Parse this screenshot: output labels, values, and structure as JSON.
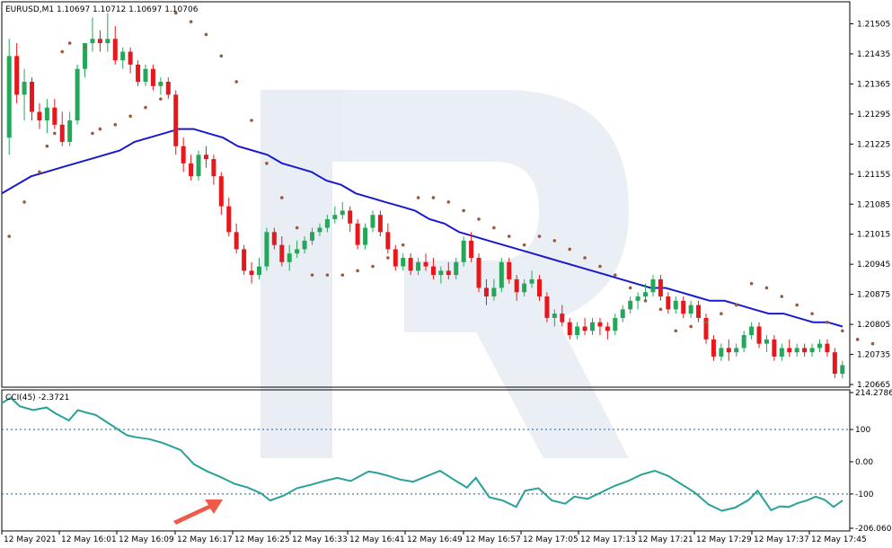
{
  "chart_data": [
    {
      "type": "candlestick",
      "title": "EURUSD,M1",
      "ohlc_header": "1.10697 1.10712 1.10697 1.10706",
      "ylim": [
        1.20665,
        1.2155
      ],
      "y_ticks": [
        "1.21505",
        "1.21435",
        "1.21365",
        "1.21295",
        "1.21225",
        "1.21155",
        "1.21085",
        "1.21015",
        "1.20945",
        "1.20875",
        "1.20805",
        "1.20735",
        "1.20665"
      ],
      "x_ticks": [
        "12 May 2021",
        "12 May 16:01",
        "12 May 16:09",
        "12 May 16:17",
        "12 May 16:25",
        "12 May 16:33",
        "12 May 16:41",
        "12 May 16:49",
        "12 May 16:57",
        "12 May 17:05",
        "12 May 17:13",
        "12 May 17:21",
        "12 May 17:29",
        "12 May 17:37",
        "12 May 17:45"
      ],
      "colors": {
        "bull": "#26a65b",
        "bear": "#e8171b",
        "ma": "#1a1acc",
        "sar": "#9c5a3c",
        "grid": "#d8d8d8"
      },
      "candles": [
        [
          1.2124,
          1.2147,
          1.212,
          1.2143
        ],
        [
          1.2143,
          1.2146,
          1.2132,
          1.2134
        ],
        [
          1.2134,
          1.214,
          1.2128,
          1.2137
        ],
        [
          1.2137,
          1.2138,
          1.2128,
          1.213
        ],
        [
          1.213,
          1.2132,
          1.2126,
          1.2128
        ],
        [
          1.2128,
          1.2133,
          1.2125,
          1.2131
        ],
        [
          1.2131,
          1.2133,
          1.2126,
          1.2127
        ],
        [
          1.2127,
          1.213,
          1.2122,
          1.2123
        ],
        [
          1.2123,
          1.213,
          1.2122,
          1.2128
        ],
        [
          1.2128,
          1.2141,
          1.2127,
          1.214
        ],
        [
          1.214,
          1.2146,
          1.2138,
          1.2146
        ],
        [
          1.2146,
          1.2152,
          1.2144,
          1.2147
        ],
        [
          1.2147,
          1.2149,
          1.2144,
          1.2146
        ],
        [
          1.2146,
          1.2153,
          1.2144,
          1.2147
        ],
        [
          1.2147,
          1.215,
          1.2141,
          1.2142
        ],
        [
          1.2142,
          1.2145,
          1.214,
          1.2144
        ],
        [
          1.2144,
          1.2145,
          1.2139,
          1.2141
        ],
        [
          1.2141,
          1.2142,
          1.2136,
          1.2137
        ],
        [
          1.2137,
          1.2141,
          1.2136,
          1.214
        ],
        [
          1.214,
          1.2141,
          1.2135,
          1.2136
        ],
        [
          1.2136,
          1.2138,
          1.2134,
          1.2137
        ],
        [
          1.2137,
          1.2138,
          1.2133,
          1.2134
        ],
        [
          1.2134,
          1.2135,
          1.212,
          1.2122
        ],
        [
          1.2122,
          1.2124,
          1.2116,
          1.2118
        ],
        [
          1.2118,
          1.212,
          1.2114,
          1.2115
        ],
        [
          1.2115,
          1.2121,
          1.2114,
          1.212
        ],
        [
          1.212,
          1.2122,
          1.2117,
          1.2119
        ],
        [
          1.2119,
          1.212,
          1.2113,
          1.2115
        ],
        [
          1.2115,
          1.2116,
          1.2106,
          1.2108
        ],
        [
          1.2108,
          1.211,
          1.2101,
          1.2102
        ],
        [
          1.2102,
          1.2104,
          1.2097,
          1.2098
        ],
        [
          1.2098,
          1.2099,
          1.2092,
          1.2093
        ],
        [
          1.2093,
          1.2095,
          1.209,
          1.2092
        ],
        [
          1.2092,
          1.2096,
          1.2091,
          1.2094
        ],
        [
          1.2094,
          1.2103,
          1.2093,
          1.2102
        ],
        [
          1.2102,
          1.2103,
          1.2098,
          1.2099
        ],
        [
          1.2099,
          1.2101,
          1.2094,
          1.2095
        ],
        [
          1.2095,
          1.2099,
          1.2093,
          1.2097
        ],
        [
          1.2097,
          1.21,
          1.2096,
          1.2098
        ],
        [
          1.2098,
          1.2101,
          1.2097,
          1.21
        ],
        [
          1.21,
          1.2103,
          1.2099,
          1.2102
        ],
        [
          1.2102,
          1.2104,
          1.2101,
          1.2103
        ],
        [
          1.2103,
          1.2106,
          1.2102,
          1.2105
        ],
        [
          1.2105,
          1.2108,
          1.2104,
          1.2106
        ],
        [
          1.2106,
          1.2109,
          1.2105,
          1.2107
        ],
        [
          1.2107,
          1.2108,
          1.2102,
          1.2104
        ],
        [
          1.2104,
          1.2105,
          1.2098,
          1.2099
        ],
        [
          1.2099,
          1.2104,
          1.2098,
          1.2103
        ],
        [
          1.2103,
          1.2107,
          1.2102,
          1.2106
        ],
        [
          1.2106,
          1.2107,
          1.2101,
          1.2102
        ],
        [
          1.2102,
          1.2104,
          1.2097,
          1.2098
        ],
        [
          1.2098,
          1.2099,
          1.2093,
          1.2094
        ],
        [
          1.2094,
          1.2097,
          1.2093,
          1.2096
        ],
        [
          1.2096,
          1.2097,
          1.2092,
          1.2093
        ],
        [
          1.2093,
          1.2096,
          1.2092,
          1.2095
        ],
        [
          1.2095,
          1.2097,
          1.2093,
          1.2094
        ],
        [
          1.2094,
          1.2096,
          1.2091,
          1.2092
        ],
        [
          1.2092,
          1.2094,
          1.209,
          1.2093
        ],
        [
          1.2093,
          1.2095,
          1.2091,
          1.2092
        ],
        [
          1.2092,
          1.2096,
          1.2091,
          1.2095
        ],
        [
          1.2095,
          1.2101,
          1.2094,
          1.21
        ],
        [
          1.21,
          1.2102,
          1.2095,
          1.2096
        ],
        [
          1.2096,
          1.2097,
          1.2088,
          1.2089
        ],
        [
          1.2089,
          1.2091,
          1.2085,
          1.2087
        ],
        [
          1.2087,
          1.2091,
          1.2086,
          1.2089
        ],
        [
          1.2089,
          1.2096,
          1.2088,
          1.2095
        ],
        [
          1.2095,
          1.2096,
          1.209,
          1.2091
        ],
        [
          1.2091,
          1.2092,
          1.2086,
          1.2088
        ],
        [
          1.2088,
          1.2091,
          1.2087,
          1.209
        ],
        [
          1.209,
          1.2093,
          1.2089,
          1.2091
        ],
        [
          1.2091,
          1.2092,
          1.2086,
          1.2087
        ],
        [
          1.2087,
          1.2088,
          1.2081,
          1.2082
        ],
        [
          1.2082,
          1.2084,
          1.208,
          1.2083
        ],
        [
          1.2083,
          1.2085,
          1.208,
          1.2081
        ],
        [
          1.2081,
          1.2082,
          1.2077,
          1.2078
        ],
        [
          1.2078,
          1.2081,
          1.2077,
          1.208
        ],
        [
          1.208,
          1.2082,
          1.2078,
          1.2079
        ],
        [
          1.2079,
          1.2082,
          1.2078,
          1.2081
        ],
        [
          1.2081,
          1.2082,
          1.2078,
          1.208
        ],
        [
          1.208,
          1.2081,
          1.2077,
          1.2079
        ],
        [
          1.2079,
          1.2083,
          1.2078,
          1.2082
        ],
        [
          1.2082,
          1.2085,
          1.2081,
          1.2084
        ],
        [
          1.2084,
          1.2087,
          1.2083,
          1.2086
        ],
        [
          1.2086,
          1.2088,
          1.2084,
          1.2087
        ],
        [
          1.2087,
          1.209,
          1.2086,
          1.2088
        ],
        [
          1.2088,
          1.2092,
          1.2087,
          1.2091
        ],
        [
          1.2091,
          1.2092,
          1.2086,
          1.2087
        ],
        [
          1.2087,
          1.2088,
          1.2083,
          1.2084
        ],
        [
          1.2084,
          1.2087,
          1.2083,
          1.2086
        ],
        [
          1.2086,
          1.2087,
          1.2082,
          1.2083
        ],
        [
          1.2083,
          1.2086,
          1.2082,
          1.2085
        ],
        [
          1.2085,
          1.2086,
          1.2081,
          1.2082
        ],
        [
          1.2082,
          1.2083,
          1.2076,
          1.2077
        ],
        [
          1.2077,
          1.2078,
          1.2072,
          1.2073
        ],
        [
          1.2073,
          1.2076,
          1.2072,
          1.2075
        ],
        [
          1.2075,
          1.2077,
          1.2072,
          1.2074
        ],
        [
          1.2074,
          1.2076,
          1.2073,
          1.2075
        ],
        [
          1.2075,
          1.2079,
          1.2074,
          1.2078
        ],
        [
          1.2078,
          1.2081,
          1.2077,
          1.208
        ],
        [
          1.208,
          1.2081,
          1.2075,
          1.2076
        ],
        [
          1.2076,
          1.2078,
          1.2074,
          1.2077
        ],
        [
          1.2077,
          1.2078,
          1.2072,
          1.2073
        ],
        [
          1.2073,
          1.2076,
          1.2072,
          1.2075
        ],
        [
          1.2075,
          1.2077,
          1.2073,
          1.2074
        ],
        [
          1.2074,
          1.2076,
          1.2073,
          1.2075
        ],
        [
          1.2075,
          1.2076,
          1.2073,
          1.2074
        ],
        [
          1.2074,
          1.2076,
          1.2073,
          1.2075
        ],
        [
          1.2075,
          1.2077,
          1.2074,
          1.2076
        ],
        [
          1.2076,
          1.2077,
          1.2073,
          1.2074
        ],
        [
          1.2074,
          1.2075,
          1.2068,
          1.2069
        ],
        [
          1.2069,
          1.2072,
          1.2068,
          1.2071
        ]
      ],
      "ma": [
        1.2111,
        1.2113,
        1.2115,
        1.2116,
        1.2117,
        1.2118,
        1.2119,
        1.212,
        1.2121,
        1.2123,
        1.2124,
        1.2125,
        1.2126,
        1.2126,
        1.2125,
        1.2124,
        1.2122,
        1.2121,
        1.212,
        1.2118,
        1.2117,
        1.2116,
        1.2114,
        1.2113,
        1.2111,
        1.211,
        1.2109,
        1.2108,
        1.2107,
        1.2105,
        1.2104,
        1.2102,
        1.2101,
        1.21,
        1.2099,
        1.2098,
        1.2097,
        1.2096,
        1.2095,
        1.2094,
        1.2093,
        1.2092,
        1.2091,
        1.209,
        1.2089,
        1.2089,
        1.2088,
        1.2087,
        1.2086,
        1.2086,
        1.2085,
        1.2084,
        1.2083,
        1.2083,
        1.2082,
        1.2081,
        1.2081,
        1.208
      ],
      "sar": [
        [
          0,
          1.2101
        ],
        [
          2,
          1.2109
        ],
        [
          4,
          1.2116
        ],
        [
          5,
          1.2122
        ],
        [
          6,
          1.2125
        ],
        [
          7,
          1.2144
        ],
        [
          8,
          1.2146
        ],
        [
          10,
          1.2145
        ],
        [
          11,
          1.2125
        ],
        [
          12,
          1.2126
        ],
        [
          14,
          1.2127
        ],
        [
          16,
          1.2129
        ],
        [
          18,
          1.2131
        ],
        [
          20,
          1.2133
        ],
        [
          22,
          1.2153
        ],
        [
          24,
          1.2151
        ],
        [
          26,
          1.2148
        ],
        [
          28,
          1.2143
        ],
        [
          30,
          1.2137
        ],
        [
          32,
          1.2128
        ],
        [
          34,
          1.2118
        ],
        [
          36,
          1.211
        ],
        [
          38,
          1.2103
        ],
        [
          40,
          1.2092
        ],
        [
          42,
          1.2092
        ],
        [
          44,
          1.2092
        ],
        [
          46,
          1.2093
        ],
        [
          48,
          1.2094
        ],
        [
          50,
          1.2096
        ],
        [
          52,
          1.2099
        ],
        [
          54,
          1.211
        ],
        [
          56,
          1.211
        ],
        [
          58,
          1.2109
        ],
        [
          60,
          1.2107
        ],
        [
          62,
          1.2105
        ],
        [
          64,
          1.2103
        ],
        [
          66,
          1.2101
        ],
        [
          68,
          1.2099
        ],
        [
          70,
          1.2101
        ],
        [
          72,
          1.21
        ],
        [
          74,
          1.2098
        ],
        [
          76,
          1.2096
        ],
        [
          78,
          1.2094
        ],
        [
          80,
          1.2092
        ],
        [
          82,
          1.2089
        ],
        [
          84,
          1.2086
        ],
        [
          86,
          1.2084
        ],
        [
          88,
          1.2079
        ],
        [
          90,
          1.208
        ],
        [
          92,
          1.2081
        ],
        [
          94,
          1.2083
        ],
        [
          96,
          1.2085
        ],
        [
          98,
          1.209
        ],
        [
          100,
          1.2089
        ],
        [
          102,
          1.2087
        ],
        [
          104,
          1.2085
        ],
        [
          106,
          1.2083
        ],
        [
          108,
          1.2081
        ],
        [
          110,
          1.2079
        ],
        [
          112,
          1.2077
        ],
        [
          114,
          1.2076
        ]
      ],
      "grid": false
    },
    {
      "type": "line",
      "title": "CCI(45) -2.3721",
      "ylim": [
        -206.0603,
        214.2786
      ],
      "y_ticks": [
        "214.2786",
        "100",
        "0.00",
        "-100",
        "-206.0603"
      ],
      "levels": [
        100,
        -100
      ],
      "colors": {
        "line": "#2aa198",
        "level": "#1e5fa0"
      },
      "x": [
        0,
        10,
        20,
        35,
        50,
        60,
        75,
        85,
        95,
        105,
        120,
        140,
        150,
        165,
        180,
        200,
        215,
        230,
        245,
        260,
        275,
        290,
        300,
        315,
        330,
        345,
        360,
        375,
        390,
        400,
        410,
        420,
        430,
        445,
        460,
        475,
        490,
        505,
        520,
        530,
        545,
        560,
        575,
        585,
        600,
        615,
        630,
        640,
        655,
        670,
        685,
        700,
        715,
        730,
        745,
        760,
        775,
        790,
        805,
        820,
        835,
        845,
        855,
        860,
        870,
        880,
        890,
        900,
        910,
        920,
        930,
        940
      ],
      "values": [
        182,
        198,
        172,
        160,
        168,
        150,
        128,
        160,
        152,
        145,
        118,
        82,
        76,
        70,
        58,
        36,
        -8,
        -30,
        -48,
        -68,
        -80,
        -98,
        -120,
        -105,
        -82,
        -72,
        -60,
        -50,
        -60,
        -45,
        -30,
        -35,
        -42,
        -55,
        -62,
        -45,
        -28,
        -55,
        -80,
        -50,
        -110,
        -120,
        -140,
        -90,
        -82,
        -120,
        -130,
        -108,
        -115,
        -95,
        -75,
        -60,
        -40,
        -28,
        -44,
        -70,
        -96,
        -132,
        -152,
        -142,
        -118,
        -90,
        -130,
        -150,
        -138,
        -140,
        -128,
        -120,
        -108,
        -118,
        -140,
        -120
      ]
    }
  ]
}
